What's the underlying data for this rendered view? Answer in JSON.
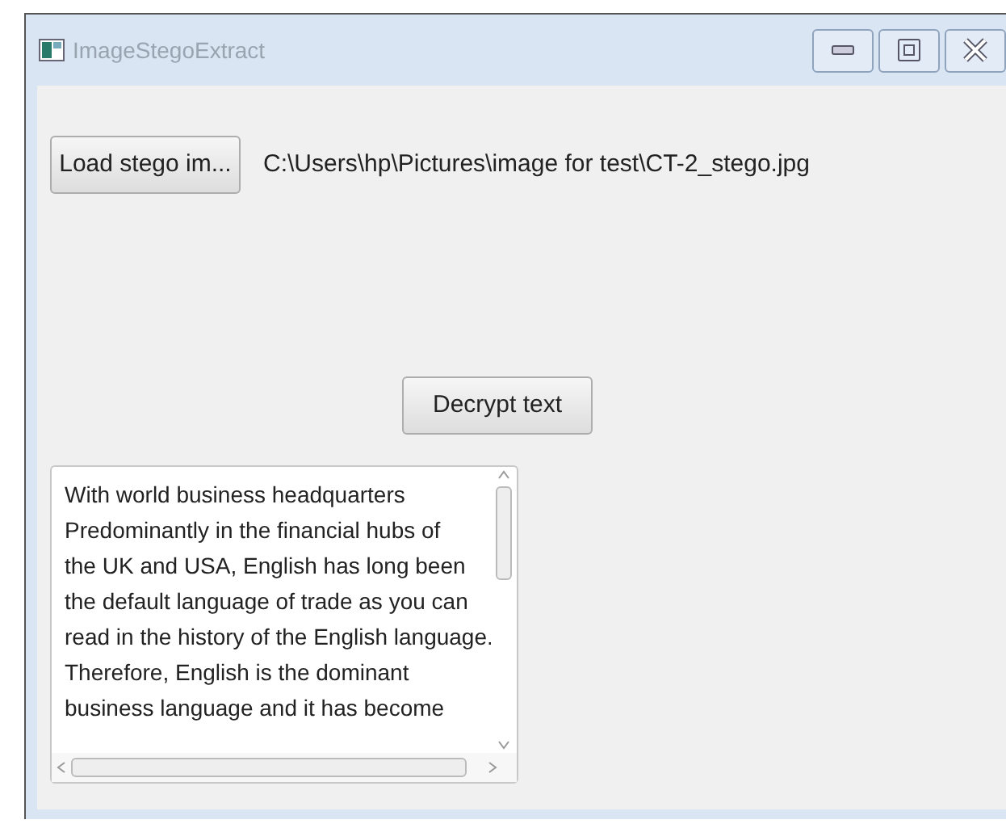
{
  "window": {
    "title": "ImageStegoExtract"
  },
  "load_button": {
    "label": "Load stego im..."
  },
  "file_path": "C:\\Users\\hp\\Pictures\\image for test\\CT-2_stego.jpg",
  "decrypt_button": {
    "label": "Decrypt text"
  },
  "output_text": {
    "lines": [
      "With world business headquarters",
      "Predominantly in the financial hubs of",
      "the UK and USA, English has long been",
      "the default language of trade as you can",
      "read in the history of the English language.",
      "Therefore, English is the dominant",
      "business language and it has become"
    ]
  }
}
